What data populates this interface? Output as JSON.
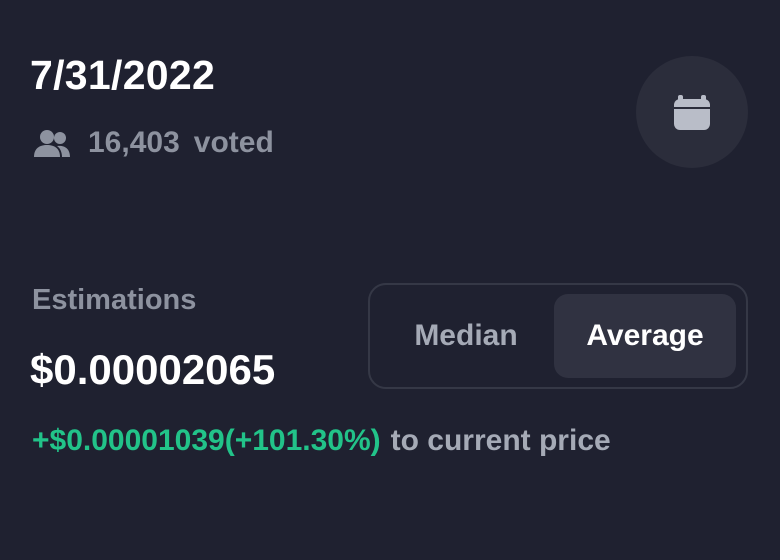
{
  "date": "7/31/2022",
  "voters": {
    "icon": "users-icon",
    "count": "16,403",
    "label": "voted"
  },
  "calendar_button": {
    "icon": "calendar-icon"
  },
  "estimations": {
    "label": "Estimations",
    "value": "$0.00002065"
  },
  "toggle": {
    "options": [
      "Median",
      "Average"
    ],
    "selected": "Average"
  },
  "change": {
    "delta": "+$0.00001039(+101.30%)",
    "suffix": "to current price"
  },
  "colors": {
    "background": "#1f2130",
    "positive": "#22c389",
    "muted": "#8d929f",
    "active_segment": "#303241"
  }
}
